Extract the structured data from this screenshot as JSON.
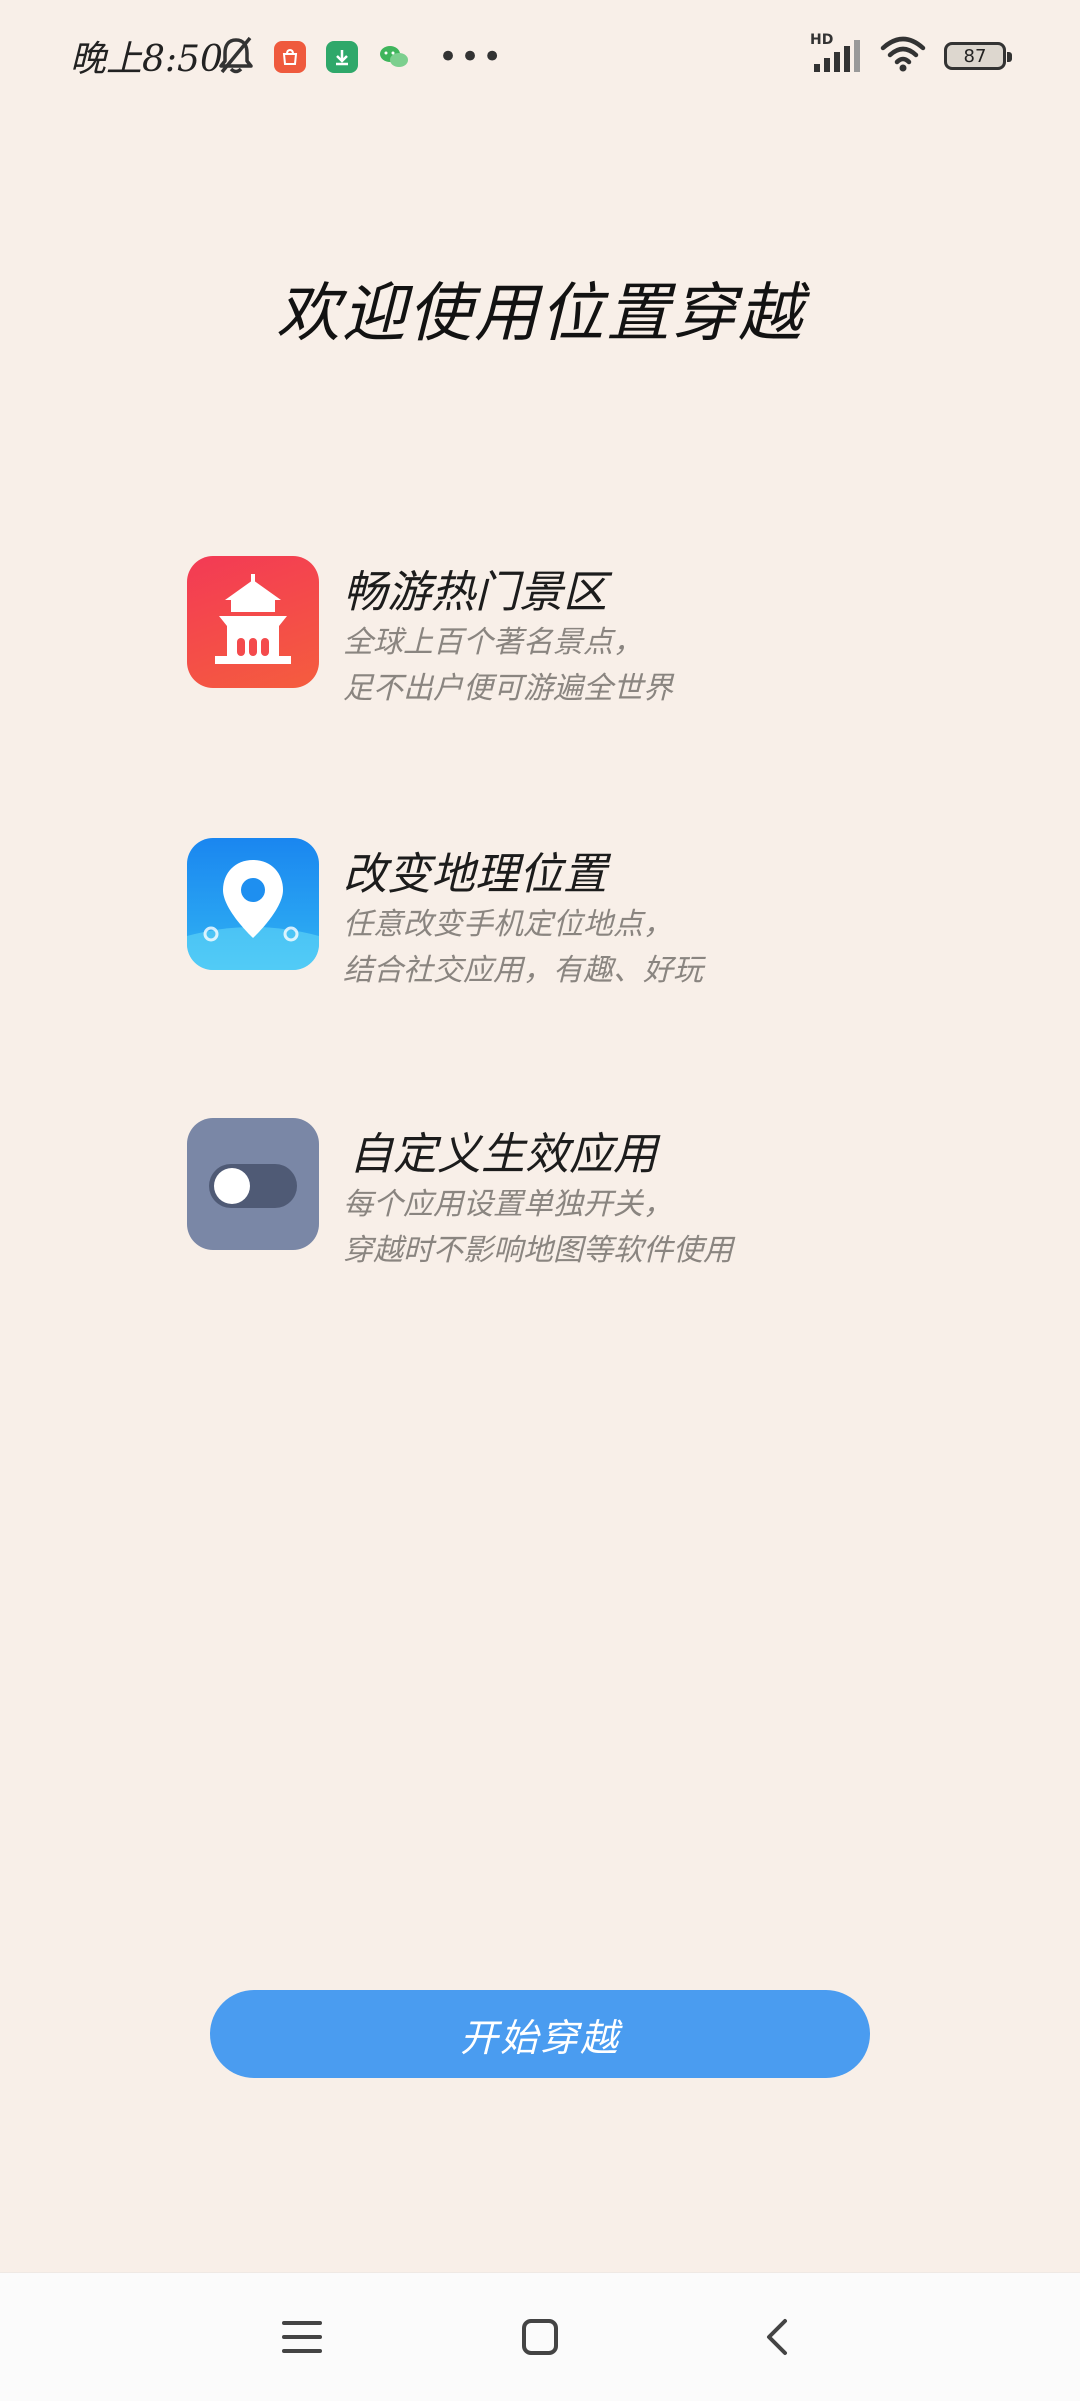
{
  "status_bar": {
    "time": "晚上8:50",
    "battery": "87",
    "network_label": "HD",
    "icons": [
      "bell-muted-icon",
      "shop-app-icon",
      "download-app-icon",
      "wechat-app-icon",
      "more-dots-icon",
      "signal-icon",
      "wifi-icon",
      "battery-icon"
    ]
  },
  "welcome": {
    "title": "欢迎使用位置穿越"
  },
  "features": [
    {
      "icon": "pagoda-icon",
      "title": "畅游热门景区",
      "desc_line1": "全球上百个著名景点，",
      "desc_line2": "足不出户便可游遍全世界"
    },
    {
      "icon": "location-pin-icon",
      "title": "改变地理位置",
      "desc_line1": "任意改变手机定位地点，",
      "desc_line2": "结合社交应用，有趣、好玩"
    },
    {
      "icon": "toggle-switch-icon",
      "title": "自定义生效应用",
      "desc_line1": "每个应用设置单独开关，",
      "desc_line2": "穿越时不影响地图等软件使用"
    }
  ],
  "start_button": {
    "label": "开始穿越"
  },
  "nav": {
    "icons": [
      "menu-icon",
      "home-icon",
      "back-icon"
    ]
  },
  "colors": {
    "background": "#f8efe8",
    "accent": "#4a9cf0",
    "icon_red": "#f2474b",
    "icon_blue": "#1e8ff0",
    "icon_gray": "#7a87a6"
  }
}
